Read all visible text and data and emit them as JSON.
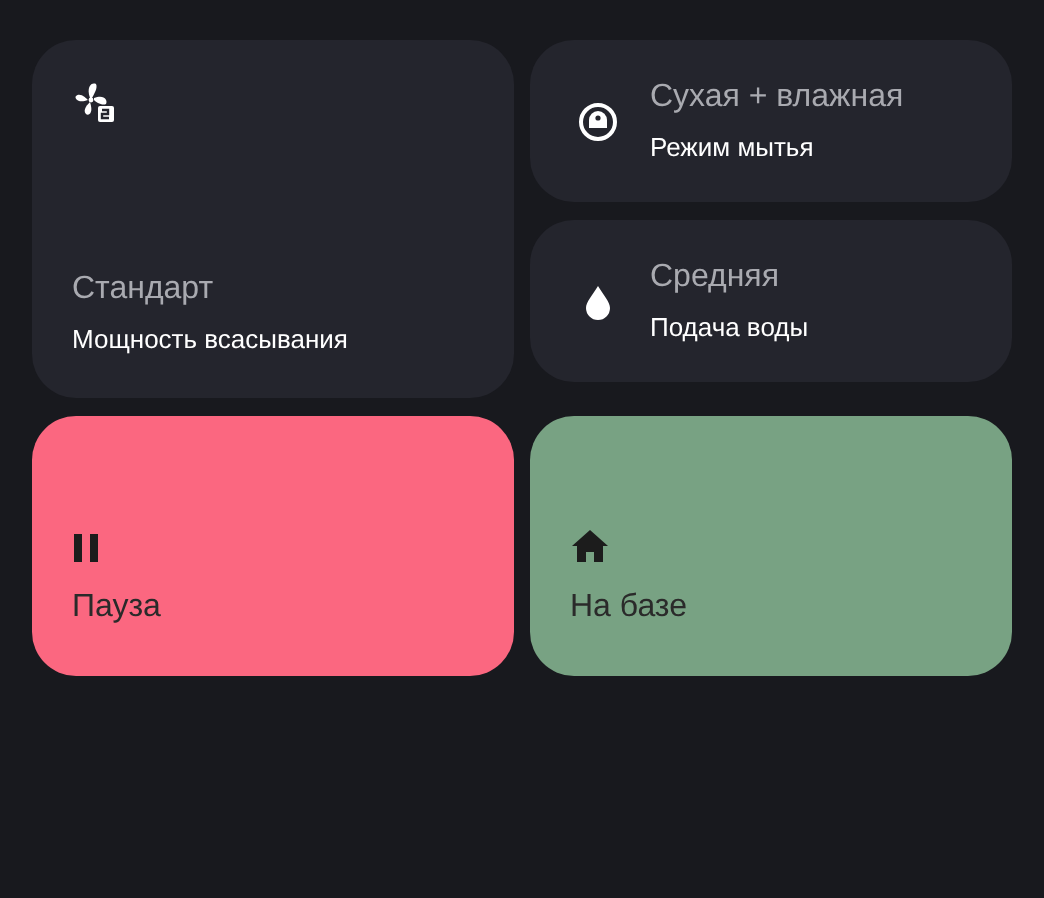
{
  "suction": {
    "value": "Стандарт",
    "label": "Мощность всасывания"
  },
  "settings": [
    {
      "value": "Сухая + влажная",
      "label": "Режим мытья"
    },
    {
      "value": "Средняя",
      "label": "Подача воды"
    }
  ],
  "actions": [
    {
      "label": "Пауза",
      "color": "#fb6780"
    },
    {
      "label": "На базе",
      "color": "#78a283"
    }
  ]
}
